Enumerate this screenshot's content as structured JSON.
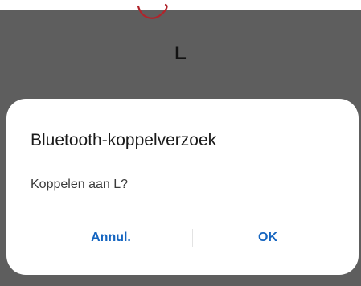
{
  "background": {
    "scrim_color": "#5e5e5e",
    "device_name": "L",
    "doodle_color": "#b0242b"
  },
  "dialog": {
    "title": "Bluetooth-koppelverzoek",
    "message": "Koppelen aan L?",
    "cancel_label": "Annul.",
    "ok_label": "OK",
    "button_color": "#1565c0"
  }
}
